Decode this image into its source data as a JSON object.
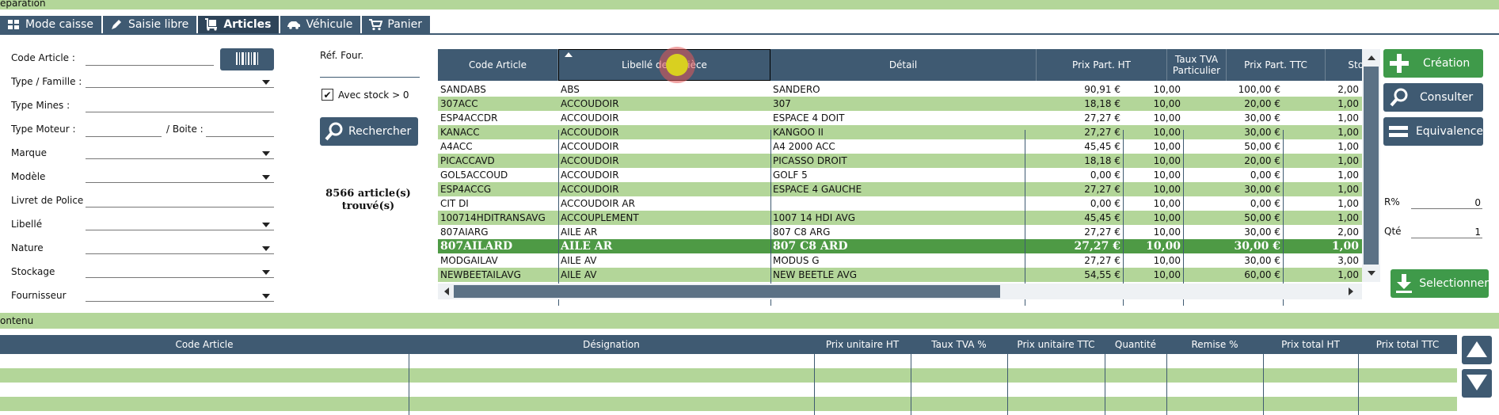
{
  "top_section": {
    "title": "éparation"
  },
  "tabs": [
    {
      "label": "Mode caisse",
      "icon": "grid-icon",
      "active": false
    },
    {
      "label": "Saisie libre",
      "icon": "pencil-icon",
      "active": false
    },
    {
      "label": "Articles",
      "icon": "cart-dolly-icon",
      "active": true
    },
    {
      "label": "Véhicule",
      "icon": "car-icon",
      "active": false
    },
    {
      "label": "Panier",
      "icon": "cart-icon",
      "active": false
    }
  ],
  "filters": {
    "code_article": "Code Article :",
    "type_famille": "Type / Famille :",
    "type_mines": "Type Mines :",
    "type_moteur": "Type Moteur :",
    "boite": "/ Boite :",
    "marque": "Marque",
    "modele": "Modèle",
    "livret_police": "Livret de Police",
    "libelle": "Libellé",
    "nature": "Nature",
    "stockage": "Stockage",
    "fournisseur": "Fournisseur"
  },
  "ref_four": {
    "label": "Réf. Four.",
    "value": ""
  },
  "avec_stock": {
    "label": "Avec stock > 0",
    "checked": true
  },
  "search_button": "Rechercher",
  "result_count": {
    "line1": "8566 article(s)",
    "line2": "trouvé(s)"
  },
  "grid": {
    "columns": {
      "code": "Code Article",
      "libelle": "Libellé de la Pièce",
      "detail": "Détail",
      "prix_ht": "Prix Part. HT",
      "tva_line1": "Taux TVA",
      "tva_line2": "Particulier",
      "prix_ttc": "Prix Part. TTC",
      "stock": "Stock"
    },
    "rows": [
      {
        "code": "SANDABS",
        "libelle": "ABS",
        "detail": "SANDERO",
        "ht": "90,91 €",
        "tva": "10,00",
        "ttc": "100,00 €",
        "stock": "2,00"
      },
      {
        "code": "307ACC",
        "libelle": "ACCOUDOIR",
        "detail": "307",
        "ht": "18,18 €",
        "tva": "10,00",
        "ttc": "20,00 €",
        "stock": "1,00"
      },
      {
        "code": "ESP4ACCDR",
        "libelle": "ACCOUDOIR",
        "detail": "ESPACE 4 DOIT",
        "ht": "27,27 €",
        "tva": "10,00",
        "ttc": "30,00 €",
        "stock": "1,00"
      },
      {
        "code": "KANACC",
        "libelle": "ACCOUDOIR",
        "detail": "KANGOO II",
        "ht": "27,27 €",
        "tva": "10,00",
        "ttc": "30,00 €",
        "stock": "1,00"
      },
      {
        "code": "A4ACC",
        "libelle": "ACCOUDOIR",
        "detail": "A4 2000 ACC",
        "ht": "45,45 €",
        "tva": "10,00",
        "ttc": "50,00 €",
        "stock": "1,00"
      },
      {
        "code": "PICACCAVD",
        "libelle": "ACCOUDOIR",
        "detail": "PICASSO DROIT",
        "ht": "18,18 €",
        "tva": "10,00",
        "ttc": "20,00 €",
        "stock": "1,00"
      },
      {
        "code": "GOL5ACCOUD",
        "libelle": "ACCOUDOIR",
        "detail": "GOLF 5",
        "ht": "0,00 €",
        "tva": "10,00",
        "ttc": "0,00 €",
        "stock": "1,00"
      },
      {
        "code": "ESP4ACCG",
        "libelle": "ACCOUDOIR",
        "detail": "ESPACE 4 GAUCHE",
        "ht": "27,27 €",
        "tva": "10,00",
        "ttc": "30,00 €",
        "stock": "1,00"
      },
      {
        "code": "CIT DI",
        "libelle": "ACCOUDOIR AR",
        "detail": "",
        "ht": "0,00 €",
        "tva": "10,00",
        "ttc": "0,00 €",
        "stock": "1,00"
      },
      {
        "code": "100714HDITRANSAVG",
        "libelle": "ACCOUPLEMENT",
        "detail": "1007 14 HDI AVG",
        "ht": "45,45 €",
        "tva": "10,00",
        "ttc": "50,00 €",
        "stock": "1,00"
      },
      {
        "code": "807AIARG",
        "libelle": "AILE AR",
        "detail": "807 C8 ARG",
        "ht": "27,27 €",
        "tva": "10,00",
        "ttc": "30,00 €",
        "stock": "2,00"
      },
      {
        "code": "807AILARD",
        "libelle": "AILE AR",
        "detail": "807 C8 ARD",
        "ht": "27,27 €",
        "tva": "10,00",
        "ttc": "30,00 €",
        "stock": "1,00",
        "selected": true
      },
      {
        "code": "MODGAILAV",
        "libelle": "AILE AV",
        "detail": "MODUS G",
        "ht": "27,27 €",
        "tva": "10,00",
        "ttc": "30,00 €",
        "stock": "3,00"
      },
      {
        "code": "NEWBEETAILAVG",
        "libelle": "AILE AV",
        "detail": "NEW BEETLE AVG",
        "ht": "54,55 €",
        "tva": "10,00",
        "ttc": "60,00 €",
        "stock": "1,00"
      }
    ]
  },
  "right_panel": {
    "creation": "Création",
    "consulter": "Consulter",
    "equivalence": "Equivalence",
    "remise_label": "R%",
    "remise_value": "0",
    "qte_label": "Qté",
    "qte_value": "1",
    "selectionner": "Selectionner"
  },
  "contenu": {
    "title": "ontenu",
    "columns": {
      "code": "Code Article",
      "designation": "Désignation",
      "pu_ht": "Prix unitaire HT",
      "tva": "Taux TVA %",
      "pu_ttc": "Prix unitaire TTC",
      "quantite": "Quantité",
      "remise": "Remise %",
      "total_ht": "Prix total HT",
      "total_ttc": "Prix total TTC"
    }
  },
  "colors": {
    "header_blue": "#3f5a72",
    "row_green": "#b3d699",
    "selected_green": "#4e9a45",
    "button_green": "#3f9a4a"
  }
}
